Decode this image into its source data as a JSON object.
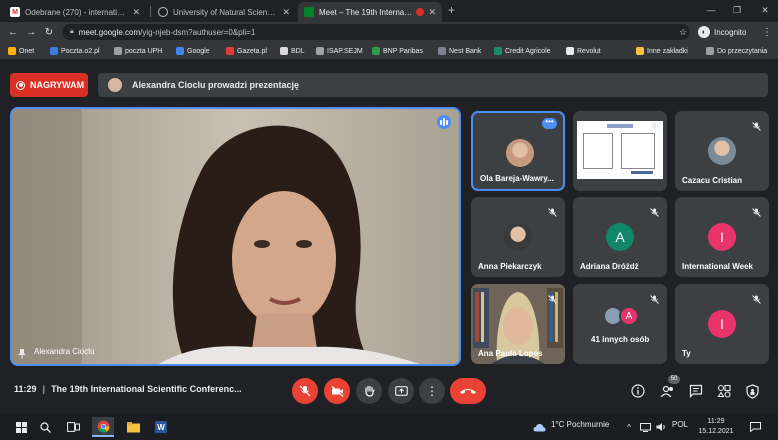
{
  "browser": {
    "tabs": [
      {
        "title": "Odebrane (270) - international.s",
        "favicon": "gmail-icon"
      },
      {
        "title": "University of Natural Sciences an",
        "favicon": "globe-icon"
      },
      {
        "title": "Meet – The 19th Internationa",
        "favicon": "meet-icon",
        "active": true
      }
    ],
    "new_tab": "+",
    "url_host": "meet.google.com",
    "url_path": "/yig-njeb-dsm?authuser=0&pli=1",
    "incognito_label": "Incognito",
    "bookmarks": [
      {
        "label": "Onet",
        "color": "#ffb300"
      },
      {
        "label": "Poczta.o2.pl",
        "color": "#3d7be0"
      },
      {
        "label": "poczta UPH",
        "color": "#9aa0a6"
      },
      {
        "label": "Google",
        "color": "#4285f4"
      },
      {
        "label": "Gazeta.pl",
        "color": "#e53935"
      },
      {
        "label": "BDL",
        "color": "#d9d9d9"
      },
      {
        "label": "ISAP.SEJM",
        "color": "#a0a4aa"
      },
      {
        "label": "BNP Paribas",
        "color": "#2e9a4a"
      },
      {
        "label": "Nest Bank",
        "color": "#7c8290"
      },
      {
        "label": "Credit Agricole",
        "color": "#1a8a6b"
      },
      {
        "label": "Revolut",
        "color": "#e8eaed"
      },
      {
        "label": "Inne zakładki",
        "color": "#f6c244"
      },
      {
        "label": "Do przeczytania",
        "color": "#9aa0a6"
      }
    ]
  },
  "meet": {
    "recording_label": "NAGRYWAM",
    "presenting_text": "Alexandra Cioclu prowadzi prezentację",
    "main_speaker": "Alexandra Cioclu",
    "participants": [
      {
        "name": "Ola Bareja-Wawry...",
        "type": "photo",
        "color": "#c79a80",
        "highlight": true
      },
      {
        "name": "",
        "type": "screen",
        "color": "#ffffff"
      },
      {
        "name": "Cazacu Cristian",
        "type": "photo",
        "color": "#7a8a96"
      },
      {
        "name": "Anna Piekarczyk",
        "type": "photo",
        "color": "#3a3a3a"
      },
      {
        "name": "Adriana Dróżdż",
        "type": "letter",
        "letter": "A",
        "color": "#12866b"
      },
      {
        "name": "International Week",
        "type": "letter",
        "letter": "I",
        "color": "#e8336b"
      },
      {
        "name": "Ana Paula Lopes",
        "type": "video",
        "color": "#8a7d6e"
      },
      {
        "name": "41 innych osób",
        "type": "others",
        "letter": "A",
        "color": "#e8336b"
      },
      {
        "name": "Ty",
        "type": "letter",
        "letter": "I",
        "color": "#e8336b"
      }
    ],
    "time": "11:29",
    "meeting_title": "The 19th International Scientific Conferenc...",
    "participant_count": "50",
    "accent_red": "#ea4335",
    "accent_blue": "#4c8df6"
  },
  "taskbar": {
    "weather": "1°C  Pochmurnie",
    "lang": "POL",
    "time": "11:29",
    "date": "15.12.2021"
  }
}
